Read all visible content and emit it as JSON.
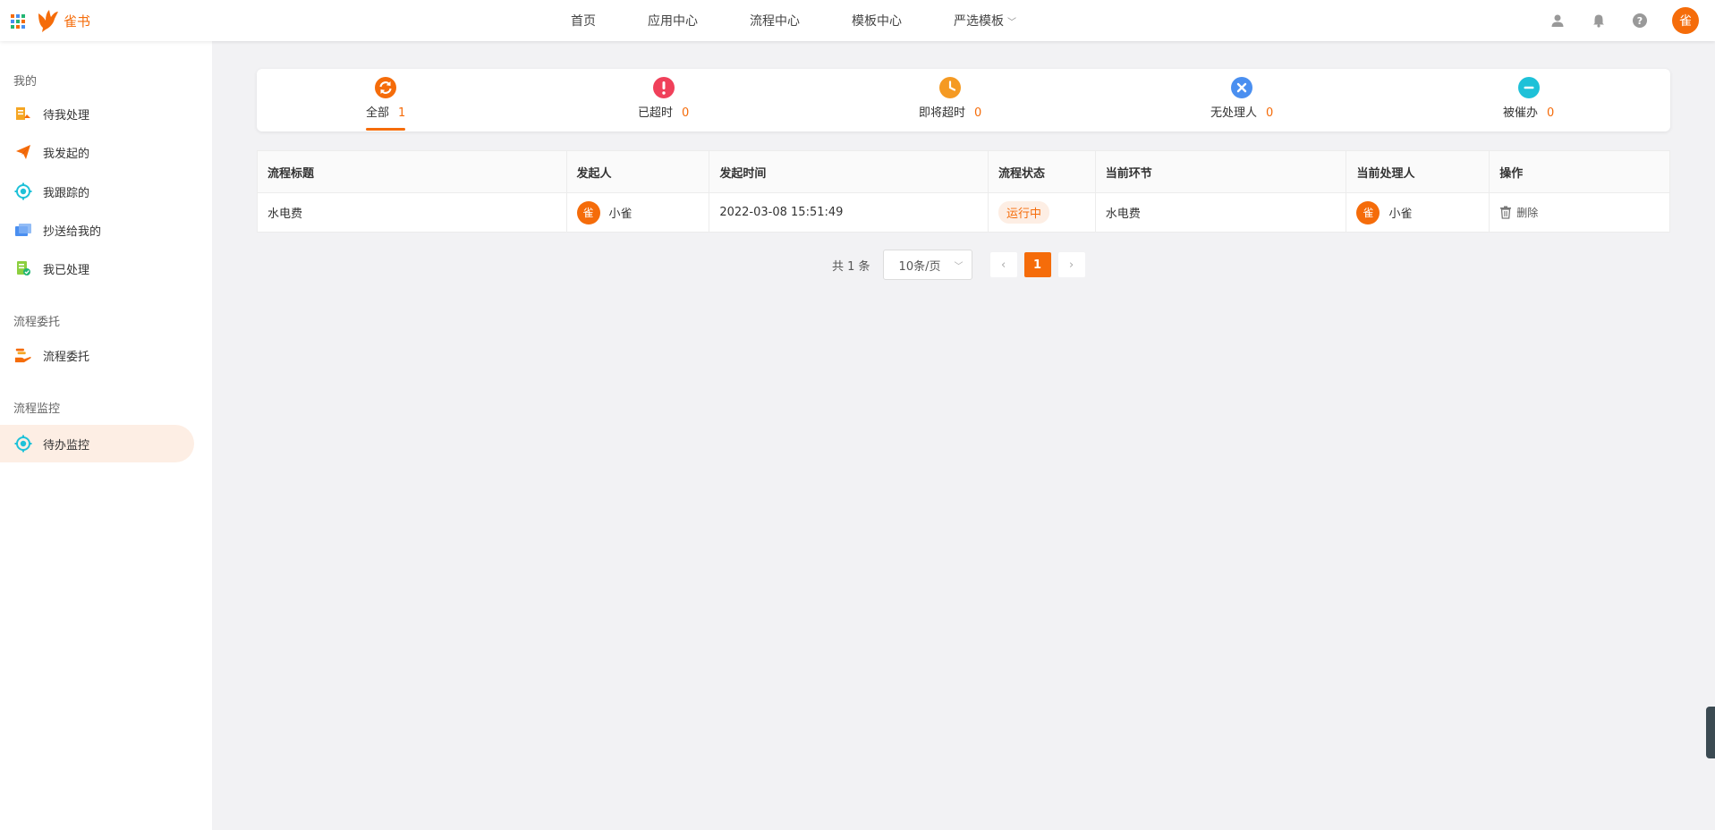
{
  "header": {
    "logo_text": "雀书",
    "nav": [
      {
        "label": "首页"
      },
      {
        "label": "应用中心"
      },
      {
        "label": "流程中心"
      },
      {
        "label": "模板中心"
      },
      {
        "label": "严选模板",
        "has_dropdown": true
      }
    ],
    "right_icons": [
      "user-icon",
      "bell-icon",
      "help-icon"
    ],
    "avatar_text": "雀"
  },
  "sidebar": {
    "groups": [
      {
        "title": "我的",
        "items": [
          {
            "label": "待我处理",
            "icon": "todo-icon"
          },
          {
            "label": "我发起的",
            "icon": "paper-plane-icon"
          },
          {
            "label": "我跟踪的",
            "icon": "track-icon"
          },
          {
            "label": "抄送给我的",
            "icon": "cc-icon"
          },
          {
            "label": "我已处理",
            "icon": "done-doc-icon"
          }
        ]
      },
      {
        "title": "流程委托",
        "items": [
          {
            "label": "流程委托",
            "icon": "delegate-hand-icon"
          }
        ]
      },
      {
        "title": "流程监控",
        "items": [
          {
            "label": "待办监控",
            "icon": "monitor-icon",
            "active": true
          }
        ]
      }
    ]
  },
  "status_tabs": [
    {
      "label": "全部",
      "count": "1",
      "icon": "refresh-icon",
      "color": "#f56c0a",
      "active": true
    },
    {
      "label": "已超时",
      "count": "0",
      "icon": "exclamation-icon",
      "color": "#f0405a"
    },
    {
      "label": "即将超时",
      "count": "0",
      "icon": "clock-icon",
      "color": "#f59a23"
    },
    {
      "label": "无处理人",
      "count": "0",
      "icon": "close-circle-icon",
      "color": "#4a8ff0"
    },
    {
      "label": "被催办",
      "count": "0",
      "icon": "minus-circle-icon",
      "color": "#1ec1d8"
    }
  ],
  "table": {
    "columns": [
      "流程标题",
      "发起人",
      "发起时间",
      "流程状态",
      "当前环节",
      "当前处理人",
      "操作"
    ],
    "rows": [
      {
        "title": "水电费",
        "initiator": {
          "avatar": "雀",
          "name": "小雀"
        },
        "start_time": "2022-03-08 15:51:49",
        "status": "运行中",
        "current_step": "水电费",
        "handler": {
          "avatar": "雀",
          "name": "小雀"
        },
        "action": "删除"
      }
    ]
  },
  "pagination": {
    "total_text": "共 1 条",
    "page_size": "10条/页",
    "current_page": "1"
  },
  "colors": {
    "accent": "#f56c0a"
  }
}
